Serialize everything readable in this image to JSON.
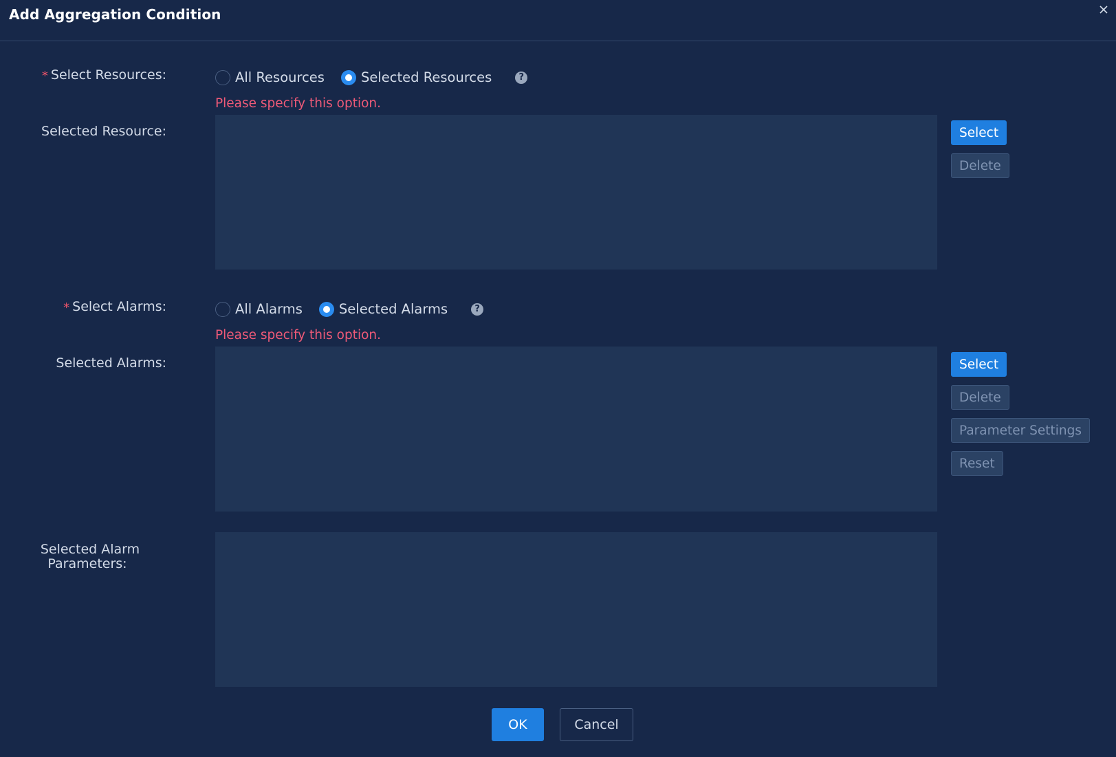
{
  "dialog": {
    "title": "Add Aggregation Condition",
    "close_label": "×"
  },
  "resources": {
    "label": "Select Resources:",
    "required_mark": "*",
    "options": [
      "All Resources",
      "Selected Resources"
    ],
    "selected_option": "Selected Resources",
    "help": "?",
    "error": "Please specify this option.",
    "list_label": "Selected Resource:",
    "buttons": {
      "select": "Select",
      "delete": "Delete"
    }
  },
  "alarms": {
    "label": "Select Alarms:",
    "required_mark": "*",
    "options": [
      "All Alarms",
      "Selected Alarms"
    ],
    "selected_option": "Selected Alarms",
    "help": "?",
    "error": "Please specify this option.",
    "list_label": "Selected Alarms:",
    "buttons": {
      "select": "Select",
      "delete": "Delete",
      "parameter_settings": "Parameter Settings",
      "reset": "Reset"
    }
  },
  "alarm_parameters": {
    "label_line1": "Selected Alarm",
    "label_line2": "Parameters:"
  },
  "footer": {
    "ok": "OK",
    "cancel": "Cancel"
  },
  "colors": {
    "background": "#172849",
    "panel": "#203556",
    "primary": "#1f7fe0",
    "error": "#ef5a78",
    "required": "#f0556b"
  },
  "icons": {
    "close": "close-icon",
    "help": "question-circle-icon"
  }
}
